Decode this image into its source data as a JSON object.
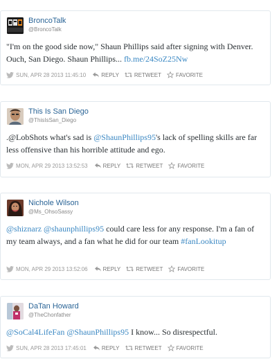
{
  "tweets": [
    {
      "name": "BroncoTalk",
      "handle": "@BroncoTalk",
      "avatar_text": "CBS BLOG",
      "segments": [
        {
          "t": "\"I'm on the good side now,\" Shaun Phillips said after signing with",
          "link": false
        },
        {
          "t": " Denver. Ouch, San Diego. Shaun Phillips... ",
          "link": false
        },
        {
          "t": "fb.me/24SoZ25Nw",
          "link": true
        }
      ],
      "date": "SUN, APR 28 2013 11:45:10"
    },
    {
      "name": "This Is San Diego",
      "handle": "@ThisIsSan_Diego",
      "segments": [
        {
          "t": ".@LobShots what's sad is ",
          "link": false
        },
        {
          "t": "@ShaunPhillips95",
          "link": true
        },
        {
          "t": "'s lack of spelling skills are far less offensive than his horrible attitude and ego.",
          "link": false
        }
      ],
      "date": "MON, APR 29 2013 13:52:53"
    },
    {
      "name": "Nichole Wilson",
      "handle": "@Ms_OhsoSassy",
      "segments": [
        {
          "t": "@shiznarz",
          "link": true
        },
        {
          "t": " ",
          "link": false
        },
        {
          "t": "@shaunphillips95",
          "link": true
        },
        {
          "t": " could care less for any response. I'm a fan of my team always, and a fan what he did for our team ",
          "link": false
        },
        {
          "t": "#fanLookitup",
          "link": true
        }
      ],
      "date": "MON, APR 29 2013 13:52:06"
    },
    {
      "name": "DaTan Howard",
      "handle": "@TheChonfather",
      "segments": [
        {
          "t": "@SoCal4LifeFan",
          "link": true
        },
        {
          "t": " ",
          "link": false
        },
        {
          "t": "@ShaunPhillips95",
          "link": true
        },
        {
          "t": " I know... So disrespectful.",
          "link": false
        }
      ],
      "date": "SUN, APR 28 2013 17:45:01"
    }
  ],
  "labels": {
    "reply": "REPLY",
    "retweet": "RETWEET",
    "favorite": "FAVORITE"
  },
  "colors": {
    "link": "#3b88c3",
    "name": "#2a6496",
    "border": "#e1e8ed"
  },
  "icons": {
    "bird": "twitter-bird-icon",
    "reply": "reply-arrow-icon",
    "retweet": "retweet-icon",
    "favorite": "star-icon"
  }
}
